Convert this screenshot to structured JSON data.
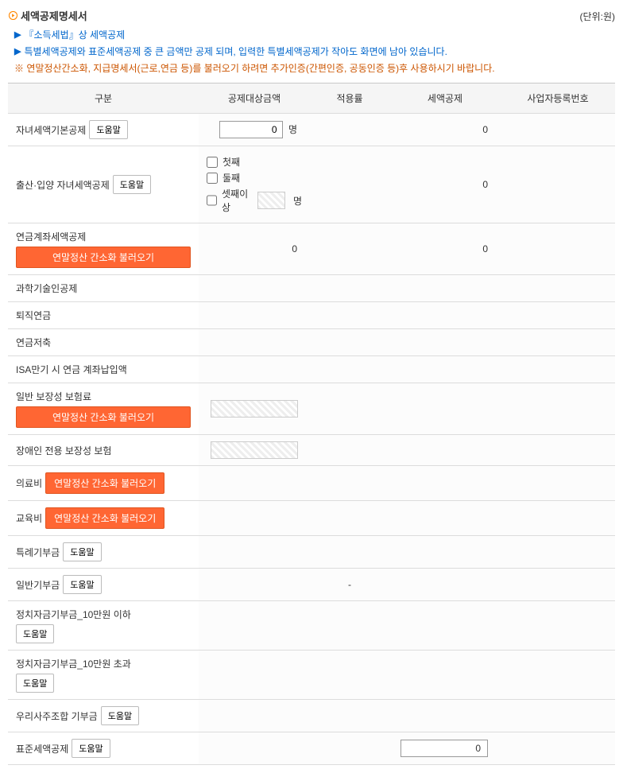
{
  "title": "세액공제명세서",
  "unit": "(단위:원)",
  "info1": "『소득세법』상 세액공제",
  "info2": "특별세액공제와 표준세액공제 중 큰 금액만 공제 되며, 입력한 특별세액공제가 작아도 화면에 남아 있습니다.",
  "warning": "※ 연말정산간소화, 지급명세서(근로,연금 등)를 불러오기 하려면 추가인증(간편인증, 공동인증 등)후 사용하시기 바랍니다.",
  "headers": {
    "gubun": "구분",
    "amount": "공제대상금액",
    "rate": "적용률",
    "deduction": "세액공제",
    "bizno": "사업자등록번호"
  },
  "buttons": {
    "help": "도움말",
    "load": "연말정산 간소화 불러오기"
  },
  "rows": {
    "child_basic": {
      "label": "자녀세액기본공제",
      "input": "0",
      "suffix": "명",
      "deduction": "0"
    },
    "birth_adopt": {
      "label": "출산·입양 자녀세액공제",
      "chk1": "첫째",
      "chk2": "둘째",
      "chk3": "셋째이상",
      "suffix": "명",
      "deduction": "0"
    },
    "pension_account": {
      "label": "연금계좌세액공제",
      "amount": "0",
      "deduction": "0"
    },
    "scientist": {
      "label": "과학기술인공제"
    },
    "retire_pension": {
      "label": "퇴직연금"
    },
    "pension_saving": {
      "label": "연금저축"
    },
    "isa": {
      "label": "ISA만기 시 연금 계좌납입액"
    },
    "general_insurance": {
      "label": "일반 보장성 보험료"
    },
    "disabled_insurance": {
      "label": "장애인 전용 보장성 보험"
    },
    "medical": {
      "label": "의료비"
    },
    "education": {
      "label": "교육비"
    },
    "special_donation": {
      "label": "특례기부금"
    },
    "general_donation": {
      "label": "일반기부금",
      "rate": "-"
    },
    "political_under": {
      "label": "정치자금기부금_10만원 이하"
    },
    "political_over": {
      "label": "정치자금기부금_10만원 초과"
    },
    "employee_stock": {
      "label": "우리사주조합 기부금"
    },
    "standard": {
      "label": "표준세액공제",
      "value": "0"
    }
  }
}
